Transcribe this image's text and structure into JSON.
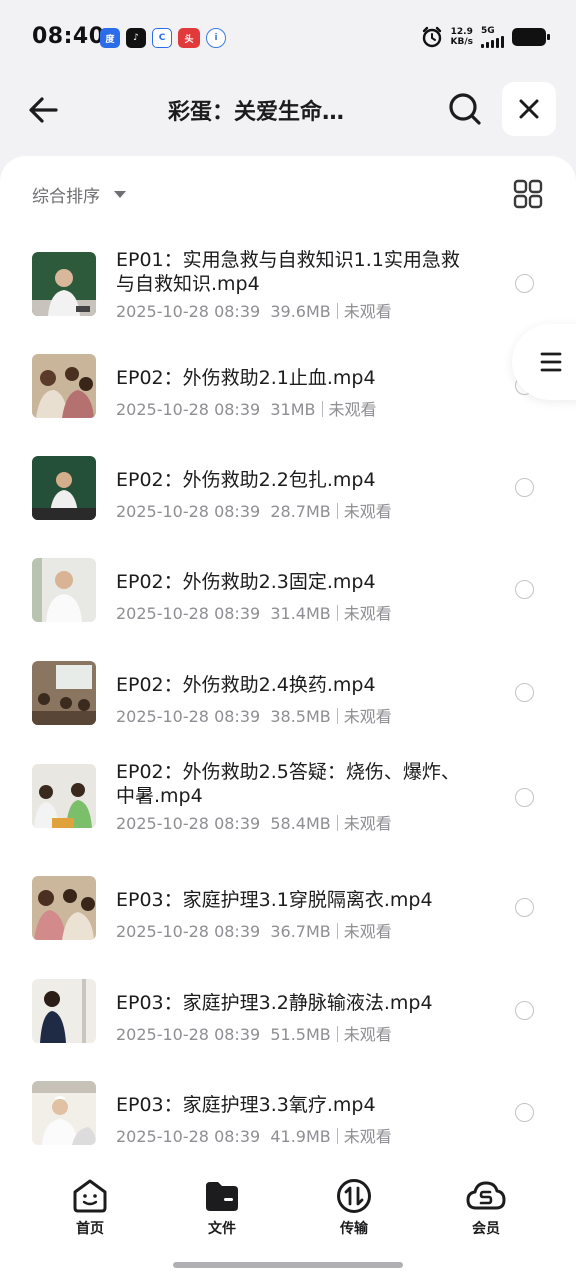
{
  "status_bar": {
    "time": "08:40",
    "net_speed_value": "12.9",
    "net_speed_unit": "KB/s",
    "network": "5G",
    "app_icons": [
      "baidu-icon",
      "tiktok-icon",
      "c-app-icon",
      "toutiao-icon",
      "ifly-icon"
    ]
  },
  "header": {
    "title": "彩蛋：关爱生命…"
  },
  "toolbar": {
    "sort_label": "综合排序"
  },
  "files": [
    {
      "name": "EP01：实用急救与自救知识1.1实用急救与自救知识.mp4",
      "date": "2025-10-28 08:39",
      "size": "39.6MB",
      "status": "未观看"
    },
    {
      "name": "EP02：外伤救助2.1止血.mp4",
      "date": "2025-10-28 08:39",
      "size": "31MB",
      "status": "未观看"
    },
    {
      "name": "EP02：外伤救助2.2包扎.mp4",
      "date": "2025-10-28 08:39",
      "size": "28.7MB",
      "status": "未观看"
    },
    {
      "name": "EP02：外伤救助2.3固定.mp4",
      "date": "2025-10-28 08:39",
      "size": "31.4MB",
      "status": "未观看"
    },
    {
      "name": "EP02：外伤救助2.4换药.mp4",
      "date": "2025-10-28 08:39",
      "size": "38.5MB",
      "status": "未观看"
    },
    {
      "name": "EP02：外伤救助2.5答疑：烧伤、爆炸、中暑.mp4",
      "date": "2025-10-28 08:39",
      "size": "58.4MB",
      "status": "未观看"
    },
    {
      "name": "EP03：家庭护理3.1穿脱隔离衣.mp4",
      "date": "2025-10-28 08:39",
      "size": "36.7MB",
      "status": "未观看"
    },
    {
      "name": "EP03：家庭护理3.2静脉输液法.mp4",
      "date": "2025-10-28 08:39",
      "size": "51.5MB",
      "status": "未观看"
    },
    {
      "name": "EP03：家庭护理3.3氧疗.mp4",
      "date": "2025-10-28 08:39",
      "size": "41.9MB",
      "status": "未观看"
    }
  ],
  "bottom_nav": [
    {
      "label": "首页",
      "icon": "home-face-icon"
    },
    {
      "label": "文件",
      "icon": "folder-icon"
    },
    {
      "label": "传输",
      "icon": "transfer-icon"
    },
    {
      "label": "会员",
      "icon": "cloud-vip-icon"
    }
  ],
  "colors": {
    "background": "#f2f2f4",
    "text_primary": "#1c1c1e",
    "text_secondary": "#8e8e93"
  }
}
